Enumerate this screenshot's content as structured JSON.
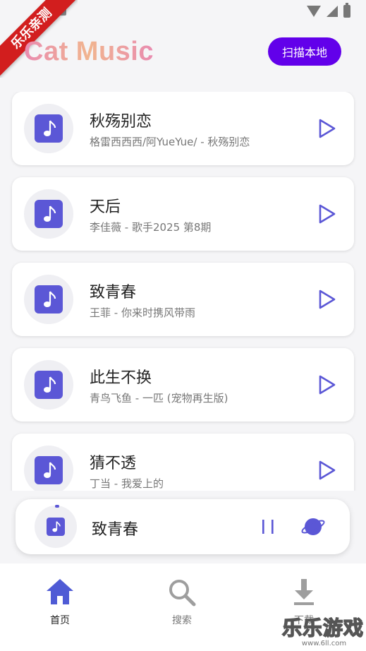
{
  "ribbon": {
    "text": "乐乐亲测"
  },
  "header": {
    "title": "Cat Music",
    "scan_label": "扫描本地"
  },
  "songs": [
    {
      "title": "秋殇别恋",
      "subtitle": "格雷西西西/阿YueYue/ - 秋殇别恋"
    },
    {
      "title": "天后",
      "subtitle": "李佳薇 - 歌手2025 第8期"
    },
    {
      "title": "致青春",
      "subtitle": "王菲 - 你来时携风带雨"
    },
    {
      "title": "此生不换",
      "subtitle": "青鸟飞鱼 - 一匹 (宠物再生版)"
    },
    {
      "title": "猜不透",
      "subtitle": "丁当 - 我爱上的"
    }
  ],
  "player": {
    "title": "致青春",
    "state": "playing"
  },
  "nav": [
    {
      "label": "首页",
      "icon": "home-icon",
      "active": true
    },
    {
      "label": "搜索",
      "icon": "search-icon",
      "active": false
    },
    {
      "label": "下载",
      "icon": "download-icon",
      "active": false
    }
  ],
  "watermark": {
    "text": "乐乐游戏",
    "url": "www.6ll.com"
  },
  "colors": {
    "accent": "#6200ea",
    "icon_purple": "#5b57d6",
    "play_outline": "#5b57d6",
    "nav_active": "#4f5bd5",
    "nav_inactive": "#9e9e9e"
  }
}
